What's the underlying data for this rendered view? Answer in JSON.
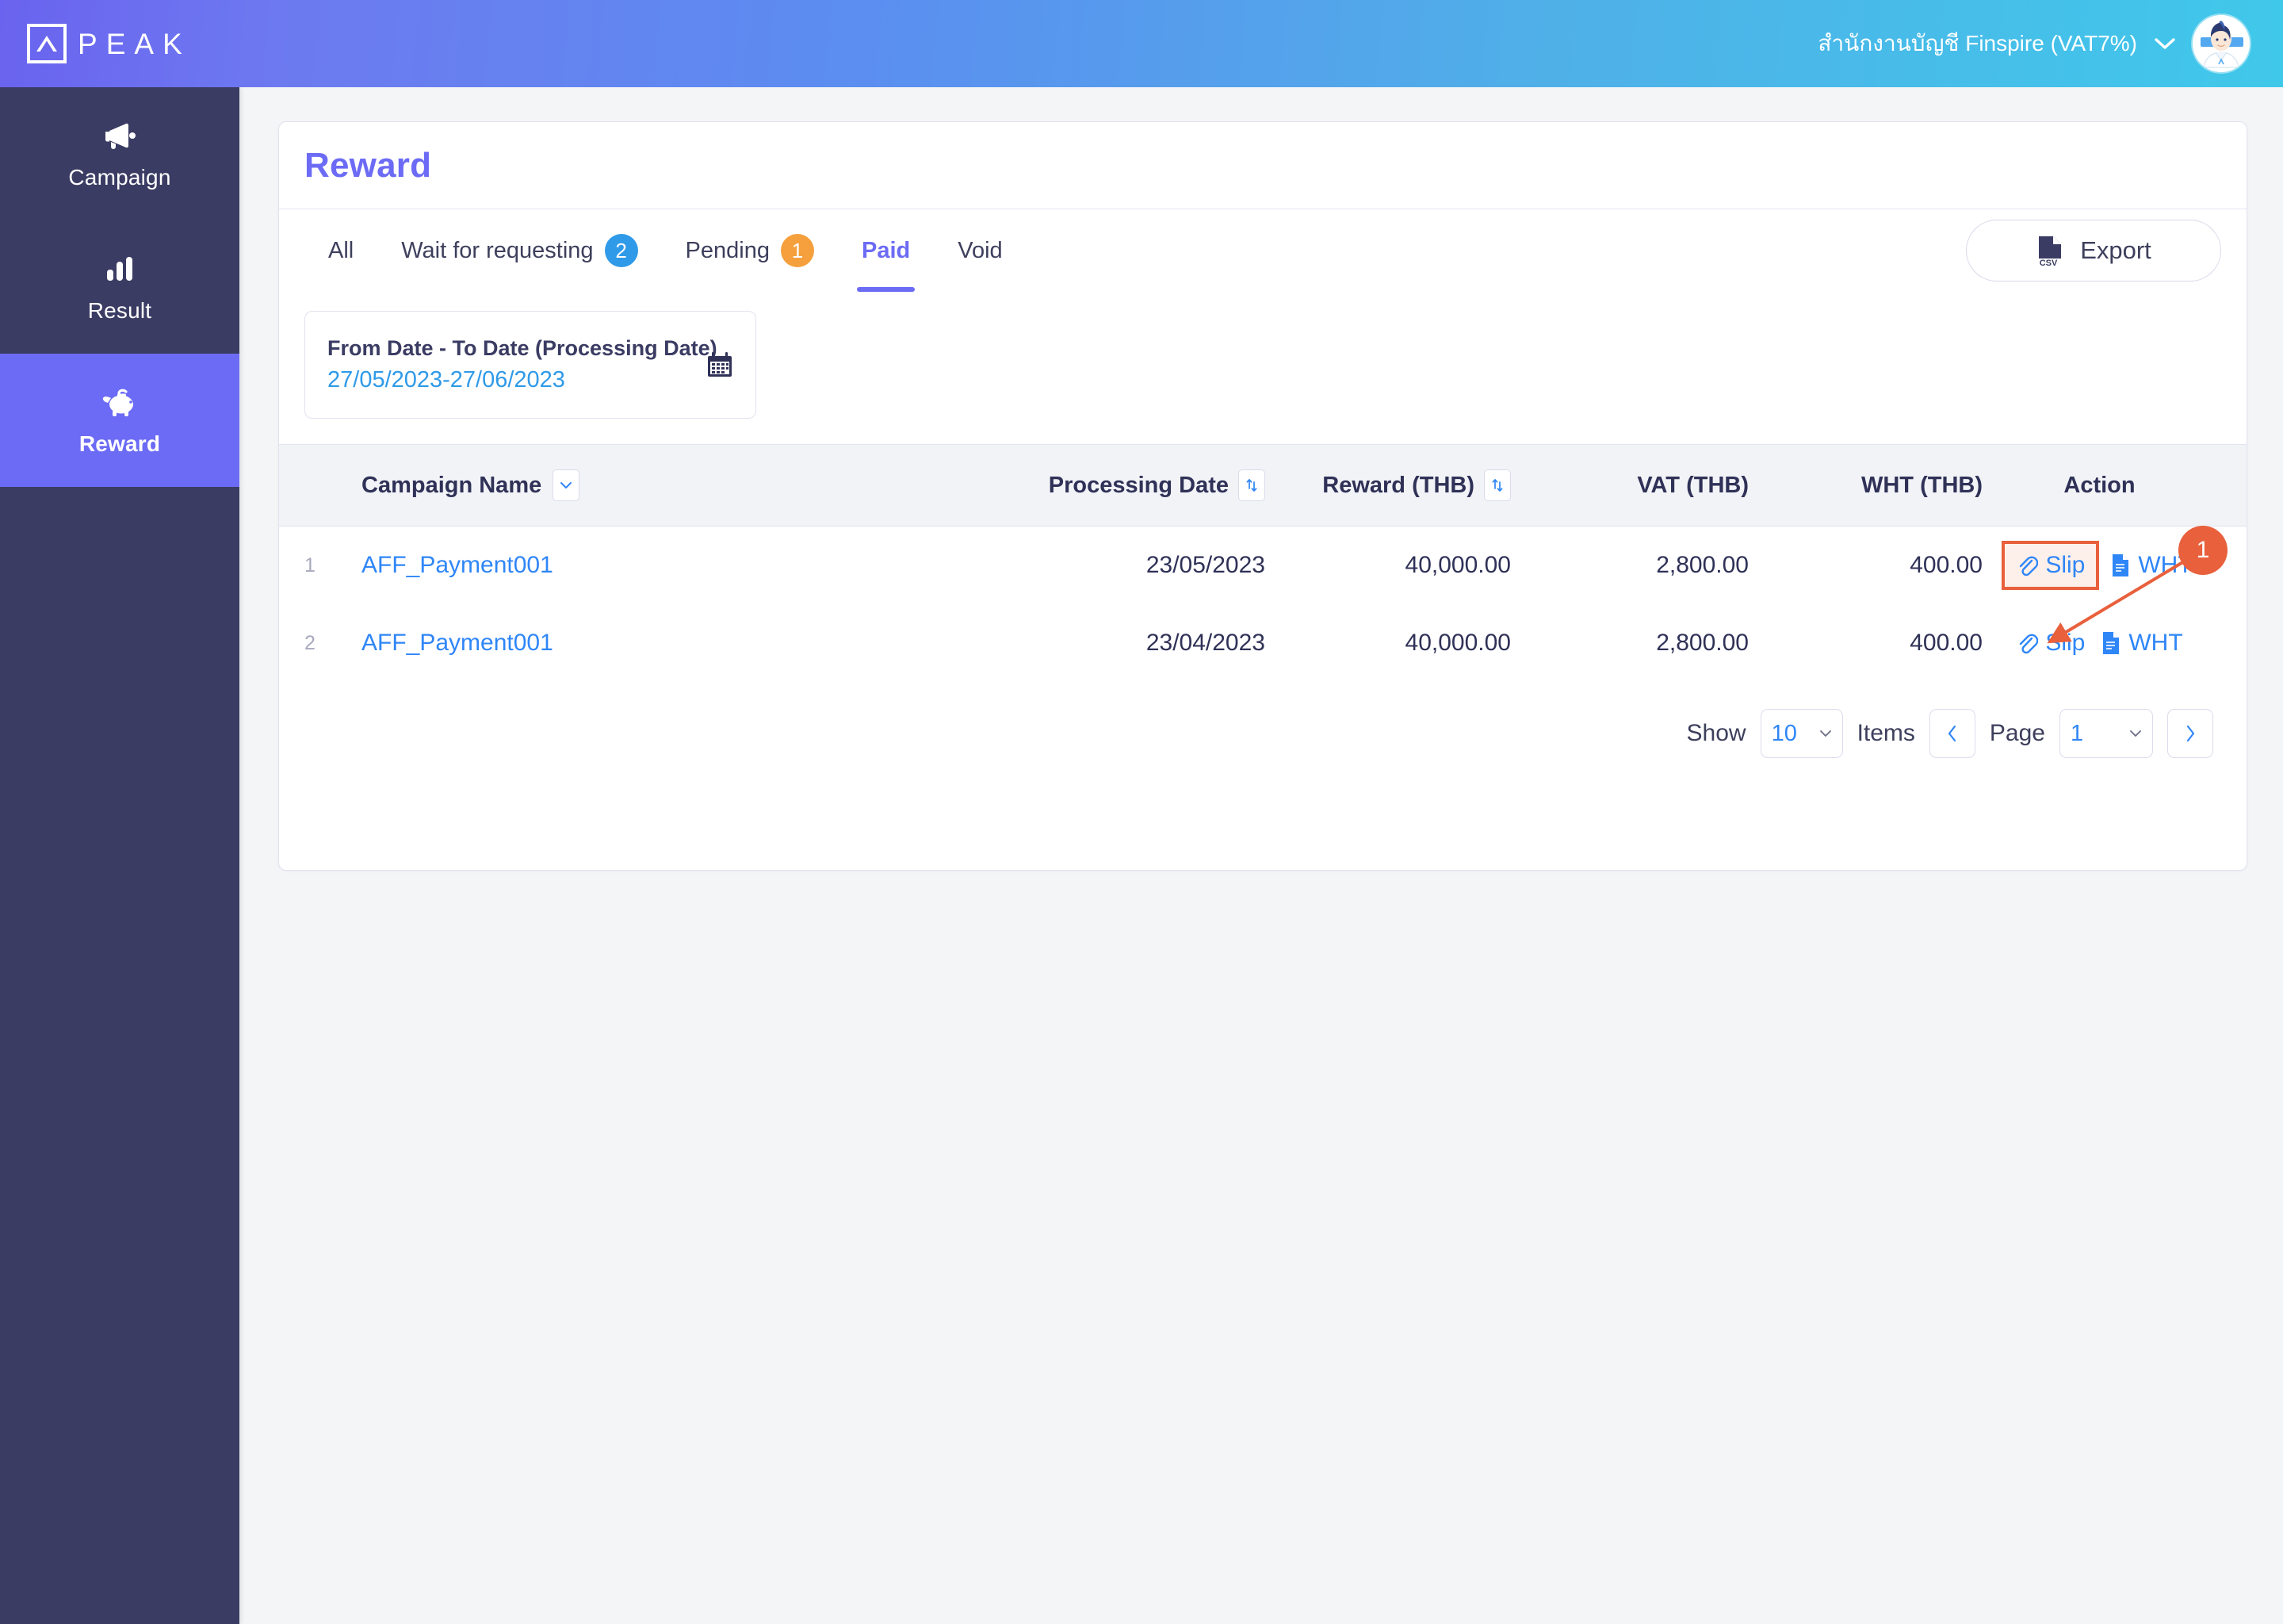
{
  "colors": {
    "brand_purple": "#6c6bf5",
    "sidebar_navy": "#3b3c63",
    "link_blue": "#2f86f7",
    "badge_blue": "#2f9ae8",
    "badge_orange": "#f5a03c",
    "annotation_orange": "#e8603c",
    "page_bg": "#f4f5f7"
  },
  "topbar": {
    "logo_text": "PEAK",
    "logo_letters": [
      "P",
      "E",
      "A",
      "K"
    ],
    "org_name": "สำนักงานบัญชี Finspire (VAT7%)",
    "chevron_icon": "chevron-down-icon",
    "avatar_icon": "user-avatar"
  },
  "sidebar": {
    "items": [
      {
        "label": "Campaign",
        "icon": "megaphone-icon",
        "active": false
      },
      {
        "label": "Result",
        "icon": "bar-chart-icon",
        "active": false
      },
      {
        "label": "Reward",
        "icon": "piggy-bank-icon",
        "active": true
      }
    ]
  },
  "page": {
    "title": "Reward"
  },
  "tabs": [
    {
      "label": "All",
      "badge": null,
      "active": false
    },
    {
      "label": "Wait for requesting",
      "badge": "2",
      "badge_color": "blue",
      "active": false
    },
    {
      "label": "Pending",
      "badge": "1",
      "badge_color": "orange",
      "active": false
    },
    {
      "label": "Paid",
      "badge": null,
      "active": true
    },
    {
      "label": "Void",
      "badge": null,
      "active": false
    }
  ],
  "toolbar": {
    "export_label": "Export",
    "export_icon": "csv-file-icon"
  },
  "date_filter": {
    "title": "From Date - To Date (Processing Date)",
    "value": "27/05/2023-27/06/2023",
    "icon": "calendar-icon"
  },
  "table": {
    "headers": {
      "index": "",
      "campaign_name": "Campaign Name",
      "processing_date": "Processing Date",
      "reward": "Reward (THB)",
      "vat": "VAT (THB)",
      "wht": "WHT (THB)",
      "action": "Action"
    },
    "header_icons": {
      "campaign_name": "chevron-down-icon",
      "processing_date": "sort-icon",
      "reward": "sort-icon"
    },
    "rows": [
      {
        "index": "1",
        "campaign_name": "AFF_Payment001",
        "processing_date": "23/05/2023",
        "reward": "40,000.00",
        "vat": "2,800.00",
        "wht": "400.00",
        "action_slip": "Slip",
        "action_wht": "WHT"
      },
      {
        "index": "2",
        "campaign_name": "AFF_Payment001",
        "processing_date": "23/04/2023",
        "reward": "40,000.00",
        "vat": "2,800.00",
        "wht": "400.00",
        "action_slip": "Slip",
        "action_wht": "WHT"
      }
    ]
  },
  "pagination": {
    "show_label": "Show",
    "items_per_page": "10",
    "items_label": "Items",
    "page_label": "Page",
    "current_page": "1",
    "prev_icon": "chevron-left-icon",
    "next_icon": "chevron-right-icon"
  },
  "annotation": {
    "number": "1"
  }
}
